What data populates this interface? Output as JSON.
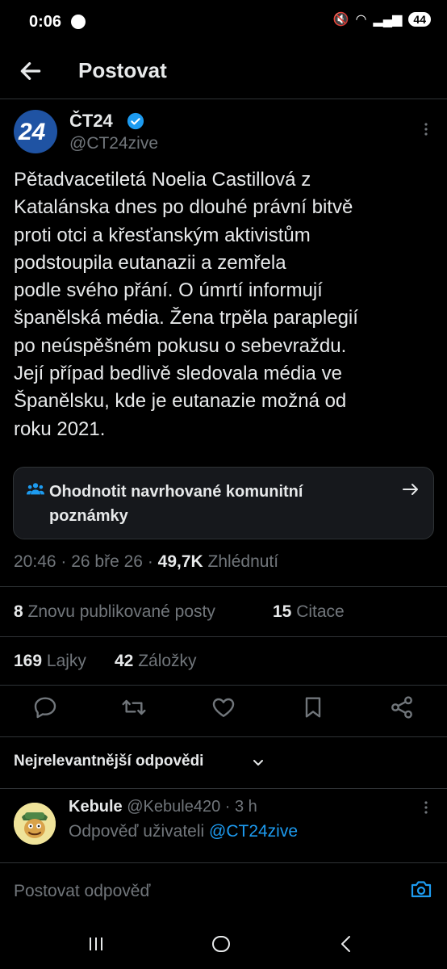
{
  "status": {
    "time": "0:06",
    "battery": "44"
  },
  "header": {
    "title": "Postovat"
  },
  "author": {
    "avatar_text": "24",
    "name": "ČT24",
    "handle": "@CT24zive"
  },
  "tweet": {
    "lines": [
      "Pětadvacetiletá Noelia Castillová z",
      "Katalánska dnes po dlouhé právní bitvě",
      "proti otci a křesťanským aktivistům",
      "podstoupila eutanazii a zemřela",
      "podle svého přání. O úmrtí informují",
      "španělská média. Žena trpěla paraplegií",
      "po neúspěšném pokusu o sebevraždu.",
      "Její případ bedlivě sledovala média ve",
      "Španělsku, kde je eutanazie možná od",
      "roku 2021."
    ]
  },
  "community_notes": {
    "label_line1": "Ohodnotit navrhované komunitní",
    "label_line2": "poznámky"
  },
  "meta": {
    "time": "20:46",
    "date": "26 bře 26",
    "views_count": "49,7K",
    "views_label": "Zhlédnutí"
  },
  "stats": {
    "reposts_count": "8",
    "reposts_label": "Znovu publikované posty",
    "quotes_count": "15",
    "quotes_label": "Citace",
    "likes_count": "169",
    "likes_label": "Lajky",
    "bookmarks_count": "42",
    "bookmarks_label": "Záložky"
  },
  "replies": {
    "sort_label": "Nejrelevantnější odpovědi"
  },
  "reply": {
    "name": "Kebule",
    "handle": "@Kebule420",
    "time": "3 h",
    "reply_to_label": "Odpověď uživateli",
    "reply_to_handle": "@CT24zive"
  },
  "composer": {
    "placeholder": "Postovat odpověď"
  },
  "colors": {
    "accent": "#1d9bf0",
    "background": "#000000",
    "text": "#e7e9ea",
    "muted": "#71767b"
  }
}
